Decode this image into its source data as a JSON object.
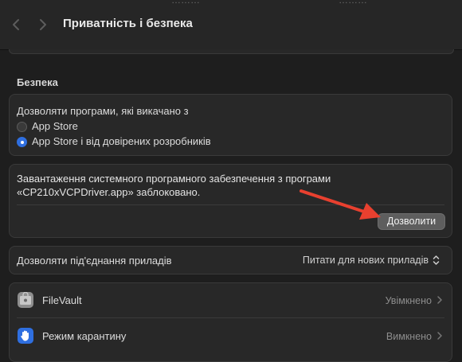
{
  "window": {
    "title": "Приватність і безпека",
    "ghost_text": "………"
  },
  "security": {
    "section_title": "Безпека",
    "allow_apps_label": "Дозволяти програми, які викачано з",
    "options": [
      {
        "label": "App Store",
        "selected": false
      },
      {
        "label": "App Store і від довірених розробників",
        "selected": true
      }
    ],
    "blocked_message": "Завантаження системного програмного забезпечення з програми «CP210xVCPDriver.app» заблоковано.",
    "allow_button": "Дозволити",
    "accessories": {
      "label": "Дозволяти під'єднання приладів",
      "value": "Питати для нових приладів"
    },
    "rows": [
      {
        "label": "FileVault",
        "value": "Увімкнено",
        "icon": "filevault-icon"
      },
      {
        "label": "Режим карантину",
        "value": "Вимкнено",
        "icon": "hand-icon"
      }
    ]
  },
  "colors": {
    "accent": "#2f6fe0",
    "arrow": "#e8402f",
    "background": "#1e1e1e",
    "card": "#282828"
  }
}
